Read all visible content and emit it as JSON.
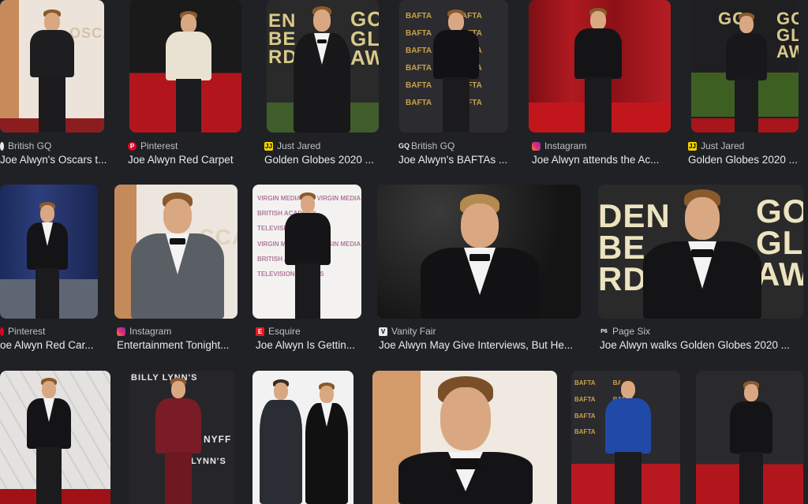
{
  "results": [
    {
      "source": "British GQ",
      "title": "Joe Alwyn's Oscars t...",
      "icon": "gq-icon"
    },
    {
      "source": "Pinterest",
      "title": "Joe Alwyn Red Carpet",
      "icon": "pinterest-icon"
    },
    {
      "source": "Just Jared",
      "title": "Golden Globes 2020 ...",
      "icon": "just-jared-icon"
    },
    {
      "source": "British GQ",
      "title": "Joe Alwyn's BAFTAs ...",
      "icon": "gq-icon"
    },
    {
      "source": "Instagram",
      "title": "Joe Alwyn attends the Ac...",
      "icon": "instagram-icon"
    },
    {
      "source": "Just Jared",
      "title": "Golden Globes 2020 ...",
      "icon": "just-jared-icon"
    },
    {
      "source": "Pinterest",
      "title": "oe Alwyn Red Car...",
      "icon": "pinterest-icon"
    },
    {
      "source": "Instagram",
      "title": "Entertainment Tonight...",
      "icon": "instagram-icon"
    },
    {
      "source": "Esquire",
      "title": "Joe Alwyn Is Gettin...",
      "icon": "esquire-icon"
    },
    {
      "source": "Vanity Fair",
      "title": "Joe Alwyn May Give Interviews, But He...",
      "icon": "vanity-fair-icon"
    },
    {
      "source": "Page Six",
      "title": "Joe Alwyn walks Golden Globes 2020 ...",
      "icon": "page-six-icon"
    }
  ],
  "image_text": {
    "oscars": "OSCARS",
    "gg_left": "DEN\nBE\nRDS",
    "gg_right": "GO\nGL\nAW",
    "bafta": "BAFTA",
    "billy_lynn": "BILLY LYNN'S",
    "nyff": "NYFF"
  },
  "colors": {
    "background": "#202124",
    "source_text": "#bdc1c6",
    "title_text": "#e8eaed",
    "red_carpet": "#b3151c"
  }
}
